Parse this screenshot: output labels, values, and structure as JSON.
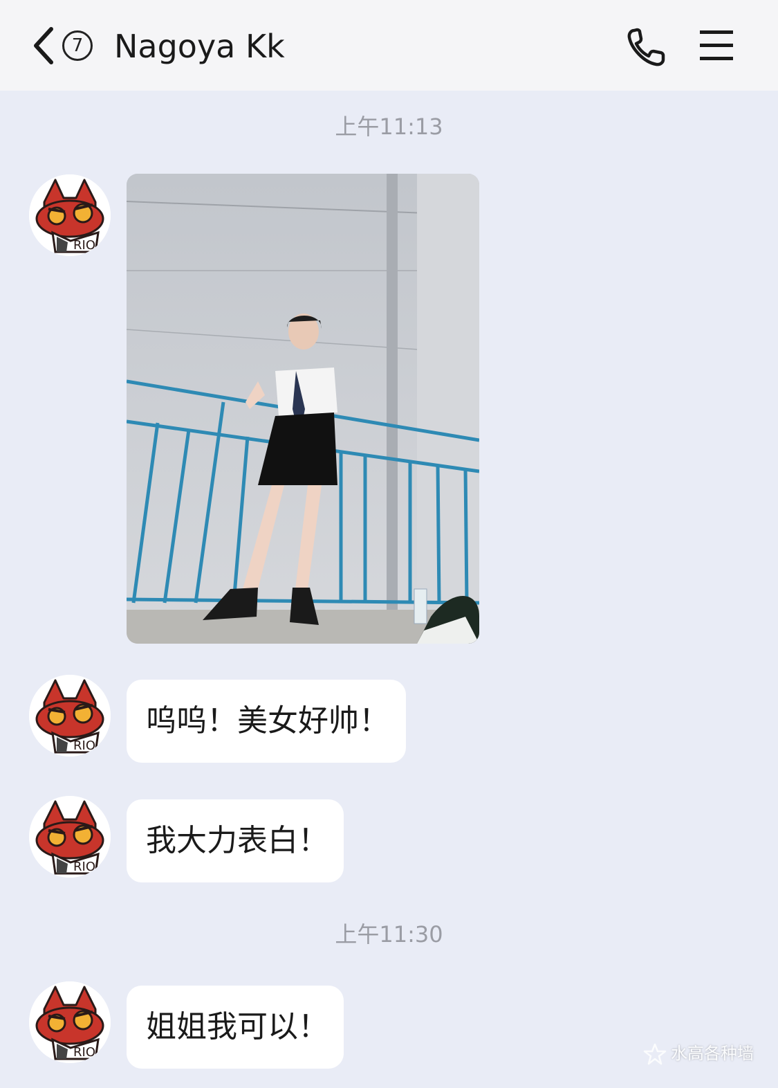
{
  "header": {
    "unread_count": "7",
    "title": "Nagoya Kk",
    "icons": [
      "back-chevron-icon",
      "phone-icon",
      "menu-icon"
    ]
  },
  "messages": {
    "timestamp_1": "上午11:13",
    "timestamp_2": "上午11:30",
    "text_1": "呜呜！美女好帅！",
    "text_2": "我大力表白！",
    "text_3": "姐姐我可以！"
  },
  "avatar": {
    "icon": "red-fox-cartoon-avatar",
    "badge_text": "RIO"
  },
  "watermark": {
    "text": "水高各种墙"
  },
  "colors": {
    "background": "#e9ecf6",
    "header": "#f5f5f7",
    "bubble": "#ffffff",
    "timestamp": "#9a9ca4",
    "avatar_red": "#c8352b"
  }
}
